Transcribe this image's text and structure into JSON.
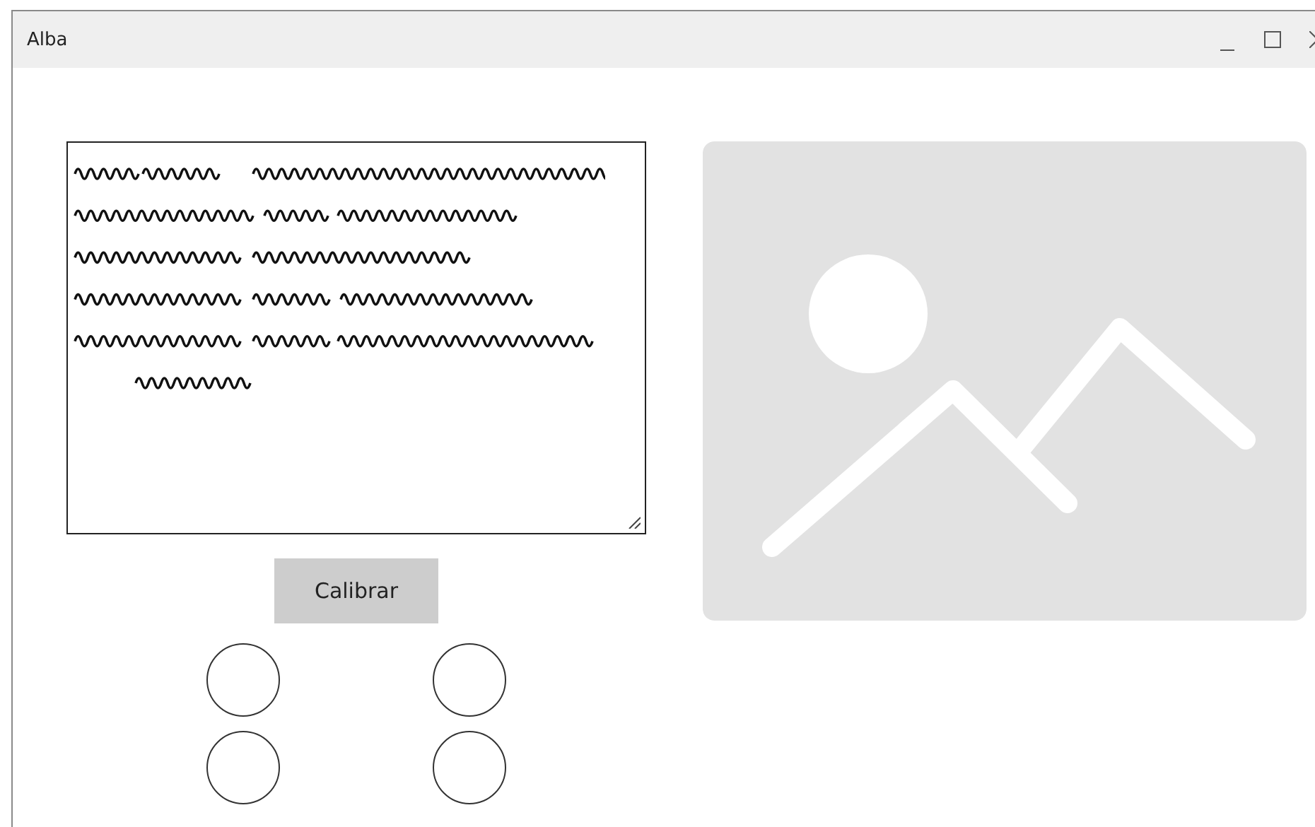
{
  "window": {
    "title": "Alba"
  },
  "text_area": {
    "scribbled": true
  },
  "image": {
    "kind": "placeholder"
  },
  "button": {
    "label": "Calibrar"
  },
  "indicators": [
    {
      "kind": "circle"
    },
    {
      "kind": "circle"
    },
    {
      "kind": "circle"
    },
    {
      "kind": "circle"
    }
  ]
}
